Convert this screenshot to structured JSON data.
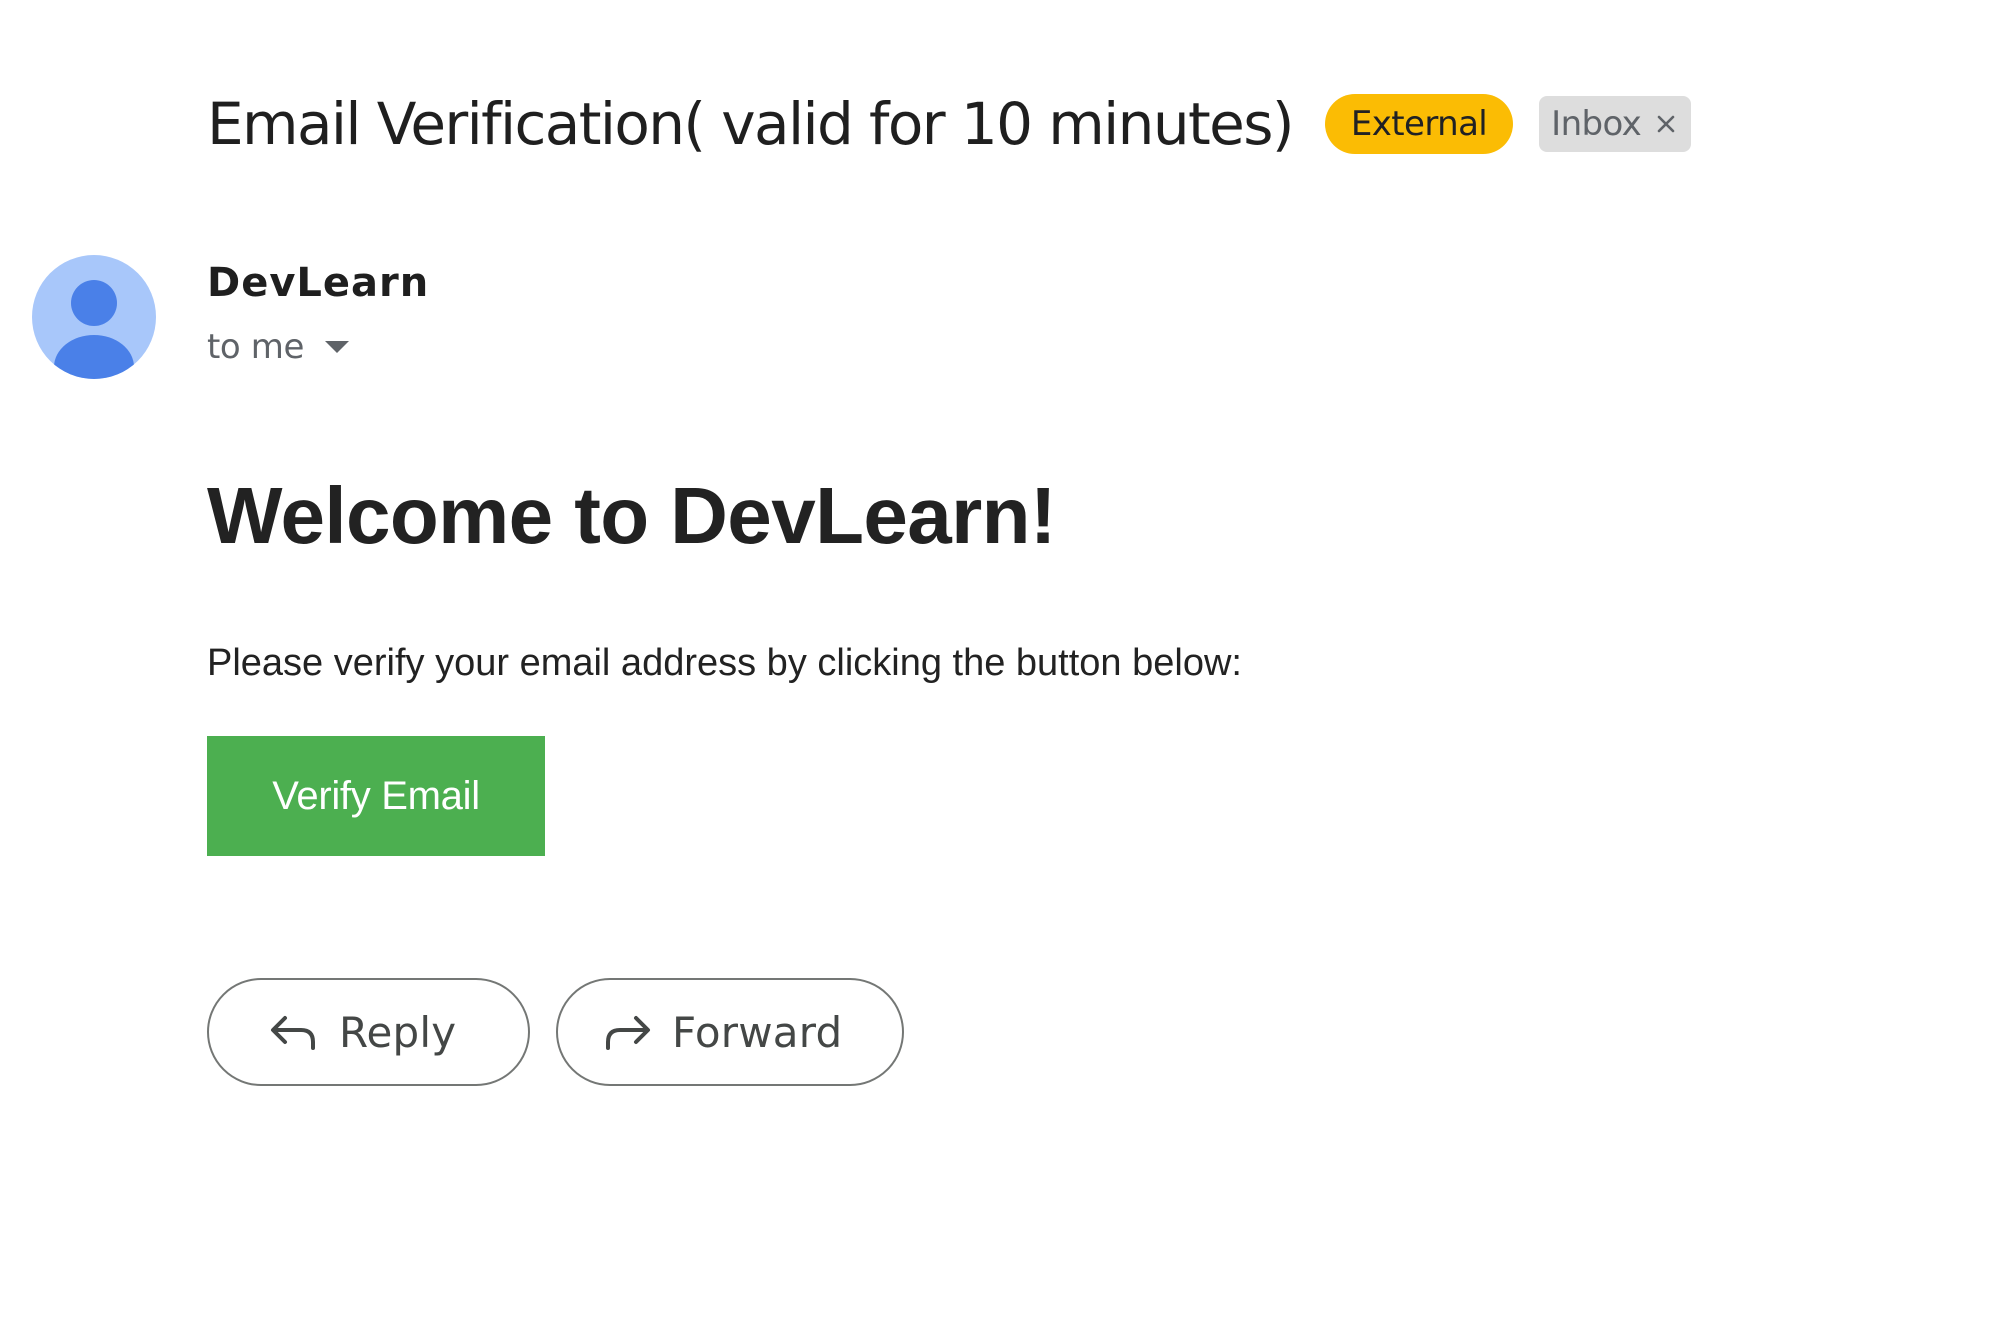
{
  "email": {
    "subject": "Email Verification( valid for 10 minutes)",
    "labels": {
      "external": "External",
      "inbox": "Inbox"
    },
    "sender": {
      "name": "DevLearn",
      "recipient": "to me",
      "avatar_icon": "person-icon"
    },
    "body": {
      "heading": "Welcome to DevLearn!",
      "instruction": "Please verify your email address by clicking the button below:",
      "verify_button": "Verify Email"
    },
    "actions": {
      "reply": "Reply",
      "forward": "Forward"
    }
  },
  "colors": {
    "external_label": "#fbbc04",
    "inbox_label": "#dddddd",
    "verify_button": "#4caf50",
    "avatar_bg": "#a8c7fa",
    "avatar_fg": "#4285f4"
  }
}
